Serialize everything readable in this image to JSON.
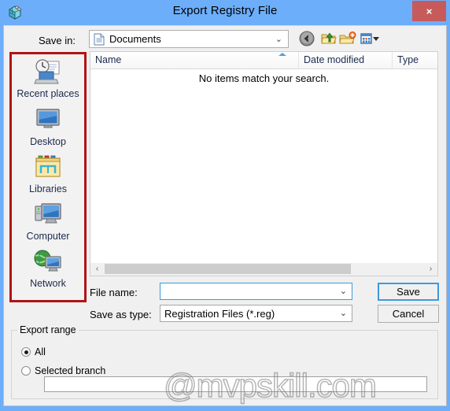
{
  "window": {
    "title": "Export Registry File",
    "icon": "registry-editor-icon",
    "close_label": "×",
    "titlebar_color": "#6daefa",
    "dialog_bg": "#f0f0f0"
  },
  "toolbar": {
    "save_in_label": "Save in:",
    "current_folder": "Documents",
    "folder_icon": "documents-icon",
    "dropdown_chevron": "⌄",
    "buttons": [
      {
        "name": "back-button",
        "icon": "back-arrow-icon"
      },
      {
        "name": "up-one-level-button",
        "icon": "up-folder-icon"
      },
      {
        "name": "new-folder-button",
        "icon": "new-folder-icon"
      },
      {
        "name": "view-menu-button",
        "icon": "views-icon"
      }
    ]
  },
  "places_bar": {
    "highlight_color": "#b01414",
    "items": [
      {
        "label": "Recent places",
        "icon": "recent-places-icon"
      },
      {
        "label": "Desktop",
        "icon": "desktop-icon"
      },
      {
        "label": "Libraries",
        "icon": "libraries-icon"
      },
      {
        "label": "Computer",
        "icon": "computer-icon"
      },
      {
        "label": "Network",
        "icon": "network-icon"
      }
    ]
  },
  "file_list": {
    "columns": [
      {
        "label": "Name"
      },
      {
        "label": "Date modified"
      },
      {
        "label": "Type"
      }
    ],
    "sort_column": "Name",
    "sort_direction": "ascending",
    "empty_message": "No items match your search.",
    "rows": []
  },
  "scrollbar": {
    "left_arrow": "‹",
    "right_arrow": "›"
  },
  "form": {
    "file_name_label": "File name:",
    "file_name_value": "",
    "save_as_type_label": "Save as type:",
    "save_as_type_value": "Registration Files (*.reg)",
    "chevron": "⌄",
    "save_button": "Save",
    "cancel_button": "Cancel"
  },
  "export_range": {
    "title": "Export range",
    "options": [
      {
        "label": "All",
        "selected": true
      },
      {
        "label": "Selected branch",
        "selected": false
      }
    ],
    "branch_value": ""
  },
  "watermark": {
    "text": "@mvpskill.com"
  }
}
